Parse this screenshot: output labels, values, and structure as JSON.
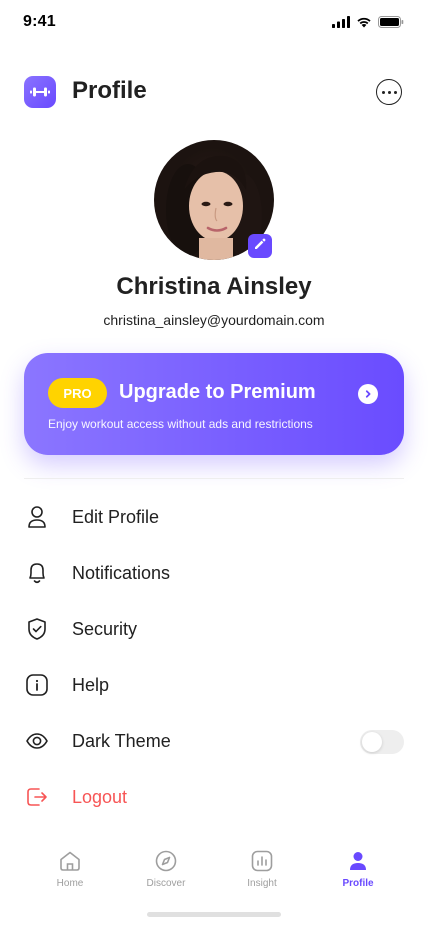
{
  "status_bar": {
    "time": "9:41"
  },
  "header": {
    "title": "Profile",
    "logo_icon": "dumbbell-icon",
    "more_icon": "more-horizontal-icon"
  },
  "profile": {
    "name": "Christina Ainsley",
    "email": "christina_ainsley@yourdomain.com",
    "edit_icon": "pencil-icon"
  },
  "premium": {
    "badge": "PRO",
    "title": "Upgrade to Premium",
    "subtitle": "Enjoy workout access without ads and restrictions",
    "arrow_icon": "chevron-right-icon"
  },
  "menu": {
    "items": [
      {
        "label": "Edit Profile",
        "icon": "person-icon"
      },
      {
        "label": "Notifications",
        "icon": "bell-icon"
      },
      {
        "label": "Security",
        "icon": "shield-check-icon"
      },
      {
        "label": "Help",
        "icon": "info-icon"
      },
      {
        "label": "Dark Theme",
        "icon": "eye-icon",
        "toggle_on": false
      },
      {
        "label": "Logout",
        "icon": "logout-icon"
      }
    ]
  },
  "bottom_nav": {
    "items": [
      {
        "label": "Home",
        "icon": "home-icon",
        "active": false
      },
      {
        "label": "Discover",
        "icon": "compass-icon",
        "active": false
      },
      {
        "label": "Insight",
        "icon": "bar-chart-icon",
        "active": false
      },
      {
        "label": "Profile",
        "icon": "profile-icon",
        "active": true
      }
    ]
  },
  "colors": {
    "accent": "#6949FF",
    "pro_badge": "#FFD300",
    "logout": "#F75555",
    "text": "#212121",
    "inactive": "#9E9E9E"
  }
}
